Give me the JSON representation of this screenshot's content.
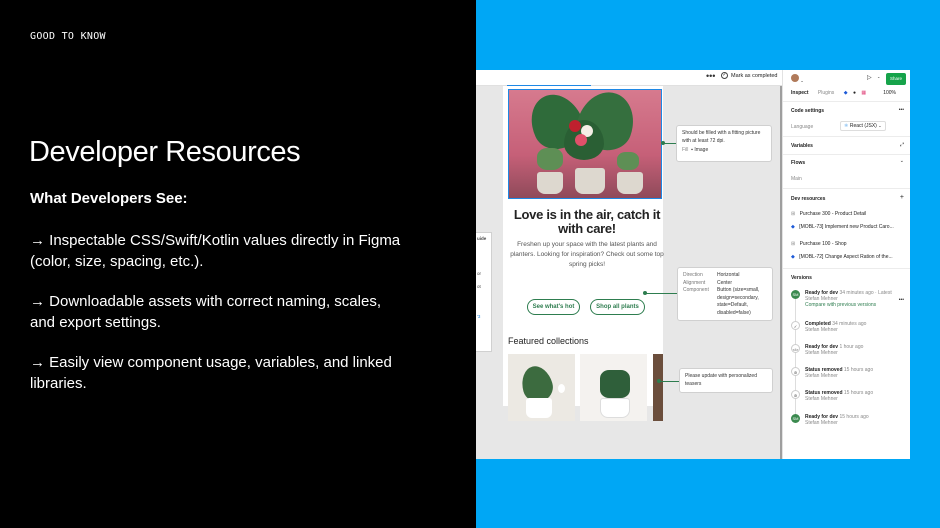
{
  "slide": {
    "eyebrow": "GOOD TO KNOW",
    "title": "Developer Resources",
    "subtitle": "What Developers See:",
    "bullets": [
      "→ Inspectable CSS/Swift/Kotlin values directly in Figma (color, size, spacing, etc.).",
      "→ Downloadable assets with correct naming, scales, and export settings.",
      "→ Easily view component usage, variables, and linked libraries."
    ]
  },
  "canvas": {
    "mark_completed": "Mark as completed",
    "headline": "Love is in the air, catch it with care!",
    "blurb": "Freshen up your space with the latest plants and planters. Looking for inspiration? Check out some top spring picks!",
    "btn_hot": "See what's hot",
    "btn_shop": "Shop all plants",
    "featured": "Featured collections",
    "annot1": {
      "text": "Should be filled with a fitting picture with at least 72 dpi.",
      "key": "Fill",
      "value": "Image"
    },
    "annot2": {
      "direction_k": "Direction",
      "direction_v": "Horizontal",
      "alignment_k": "Alignment",
      "alignment_v": "Center",
      "component_k": "Component",
      "component_v": "Button (size=small, design=secondary, state=Default, disabled=false)"
    },
    "annot3": "Please update with personalized teasers",
    "stub": [
      "uide",
      "or",
      "ot",
      "'3"
    ]
  },
  "panel": {
    "tab_inspect": "Inspect",
    "tab_plugins": "Plugins",
    "zoom": "100%",
    "share": "Share",
    "code_settings": "Code settings",
    "language_label": "Language",
    "language_value": "React (JSX)",
    "variables": "Variables",
    "flows": "Flows",
    "flow_main": "Main",
    "dev_resources": "Dev resources",
    "res1": "Purchase 300 - Product Detail",
    "res1_link": "[MOBL-73] Implement new Product Caro...",
    "res2": "Purchase 100 - Shop",
    "res2_link": "[MOBL-72] Change Aspect Ration of the...",
    "versions": "Versions",
    "v1_title": "Ready for dev",
    "v1_time": "34 minutes ago · Latest",
    "v1_user": "Stefan Mehner",
    "v1_compare": "Compare with previous versions",
    "v2_title": "Completed",
    "v2_time": "34 minutes ago",
    "v2_user": "Stefan Mehner",
    "v3_title": "Ready for dev",
    "v3_time": "1 hour ago",
    "v3_user": "Stefan Mehner",
    "v4_title": "Status removed",
    "v4_time": "15 hours ago",
    "v4_user": "Stefan Mehner",
    "v5_title": "Status removed",
    "v5_time": "15 hours ago",
    "v5_user": "Stefan Mehner",
    "v6_title": "Ready for dev",
    "v6_time": "15 hours ago",
    "v6_user": "Stefan Mehner"
  },
  "colors": {
    "blue_bg": "#00a7f5",
    "black_bg": "#000000",
    "brand_green": "#2e7d4f",
    "share_green": "#16a34a"
  }
}
